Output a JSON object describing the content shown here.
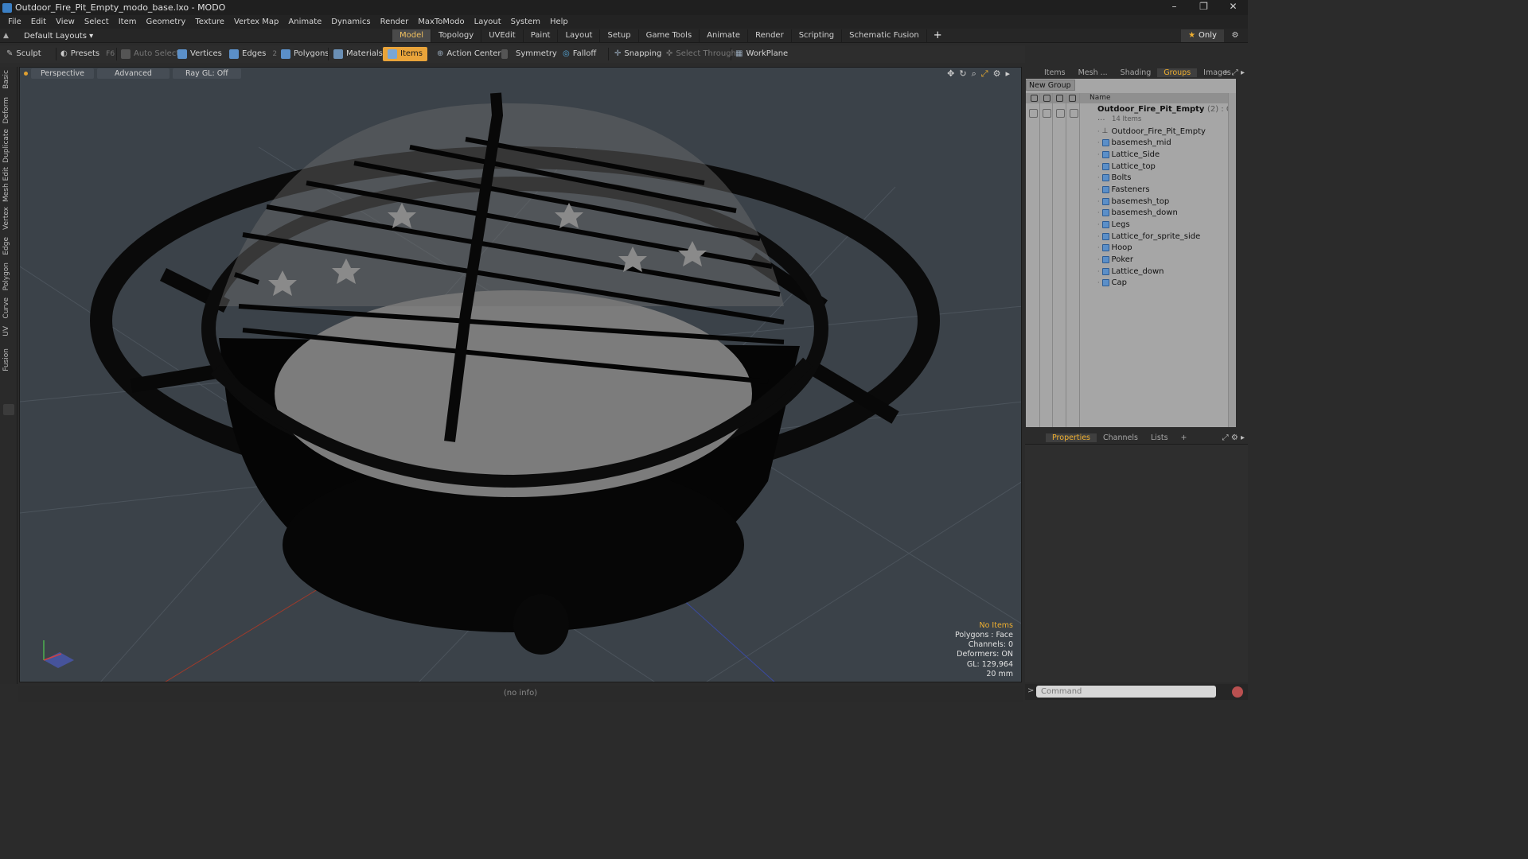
{
  "window": {
    "title": "Outdoor_Fire_Pit_Empty_modo_base.lxo - MODO",
    "controls": [
      "–",
      "❐",
      "✕"
    ]
  },
  "menu": [
    "File",
    "Edit",
    "View",
    "Select",
    "Item",
    "Geometry",
    "Texture",
    "Vertex Map",
    "Animate",
    "Dynamics",
    "Render",
    "MaxToModo",
    "Layout",
    "System",
    "Help"
  ],
  "layout_selector": "Default Layouts ▾",
  "mode_tabs": [
    "Model",
    "Topology",
    "UVEdit",
    "Paint",
    "Layout",
    "Setup",
    "Game Tools",
    "Animate",
    "Render",
    "Scripting",
    "Schematic Fusion"
  ],
  "mode_tab_add": "+",
  "only_label": "Only",
  "toolbar": {
    "sculpt": "Sculpt",
    "presets": "Presets",
    "presets_key": "F6",
    "auto_select": "Auto Select",
    "vertices": "Vertices",
    "vertices_count": "1",
    "edges": "Edges",
    "edges_count": "2",
    "polygons": "Polygons",
    "materials": "Materials",
    "items": "Items",
    "action_center": "Action Center",
    "symmetry": "Symmetry",
    "falloff": "Falloff",
    "snapping": "Snapping",
    "select_through": "Select Through",
    "workplane": "WorkPlane"
  },
  "left_tabs": [
    "Basic",
    "Deform",
    "Duplicate",
    "Mesh Edit",
    "Vertex",
    "Edge",
    "Polygon",
    "Curve",
    "UV",
    "Fusion"
  ],
  "viewport": {
    "view_mode": "Perspective",
    "shading": "Advanced",
    "raygl": "Ray GL: Off",
    "stats": {
      "selection": "No Items",
      "polygons": "Polygons : Face",
      "channels": "Channels: 0",
      "deformers": "Deformers: ON",
      "gl": "GL: 129,964",
      "unit": "20 mm"
    }
  },
  "status_bar": "(no info)",
  "right_panel": {
    "tabs": [
      "Items",
      "Mesh ...",
      "Shading",
      "Groups",
      "Images"
    ],
    "active_tab": "Groups",
    "new_group": "New Group",
    "column_name": "Name",
    "group": {
      "name": "Outdoor_Fire_Pit_Empty",
      "meta": "(2) : Gr ...",
      "count": "14 Items"
    },
    "items": [
      "Outdoor_Fire_Pit_Empty",
      "basemesh_mid",
      "Lattice_Side",
      "Lattice_top",
      "Bolts",
      "Fasteners",
      "basemesh_top",
      "basemesh_down",
      "Legs",
      "Lattice_for_sprite_side",
      "Hoop",
      "Poker",
      "Lattice_down",
      "Cap"
    ]
  },
  "bottom_panel": {
    "tabs": [
      "Properties",
      "Channels",
      "Lists"
    ],
    "active_tab": "Properties",
    "add": "+"
  },
  "command": {
    "prompt": ">",
    "placeholder": "Command"
  },
  "colors": {
    "accent": "#f0b030",
    "viewport_bg": "#3b4249",
    "items_active": "#e9a43a"
  }
}
